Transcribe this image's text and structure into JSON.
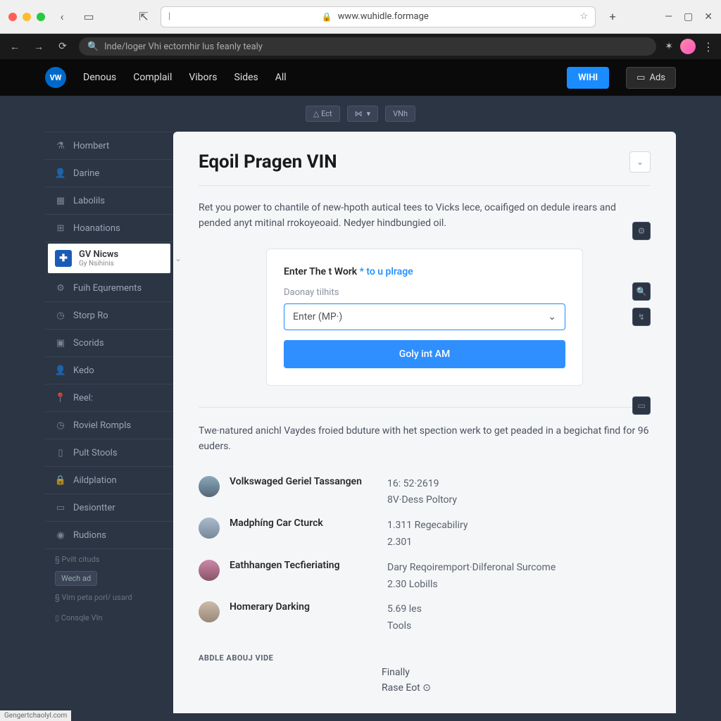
{
  "chrome": {
    "url": "www.wuhidle.formage",
    "inner_search": "lnde/loger Vhi ectornhir lus feanly tealy"
  },
  "nav": {
    "items": [
      "Denous",
      "Complail",
      "Vibors",
      "Sides",
      "All"
    ],
    "cta": "WIHI",
    "ads": "Ads"
  },
  "pills": [
    "△ Ect",
    "⋈",
    "VNh"
  ],
  "sidebar": {
    "items": [
      {
        "icon": "⚗",
        "label": "Hombert"
      },
      {
        "icon": "👤",
        "label": "Darine"
      },
      {
        "icon": "▦",
        "label": "Labolils"
      },
      {
        "icon": "⊞",
        "label": "Hoanations"
      },
      {
        "icon": "✚",
        "label": "GV Nicws",
        "sub": "Gy Nsihinis",
        "active": true
      },
      {
        "icon": "⚙",
        "label": "Fuih Equrements"
      },
      {
        "icon": "◷",
        "label": "Storp Ro"
      },
      {
        "icon": "▣",
        "label": "Scorids"
      },
      {
        "icon": "👤",
        "label": "Kedo"
      },
      {
        "icon": "📍",
        "label": "Reel:"
      },
      {
        "icon": "◷",
        "label": "Roviel Rompls"
      },
      {
        "icon": "▯",
        "label": "Pult Stools"
      },
      {
        "icon": "🔒",
        "label": "Aildplation"
      },
      {
        "icon": "▭",
        "label": "Desiontter"
      },
      {
        "icon": "◉",
        "label": "Rudions"
      }
    ],
    "notes": [
      "§ Pvilt cituds",
      "Wech ad",
      "§ Vim peta porl/ usard",
      "▯ Consqle VIn"
    ]
  },
  "content": {
    "title": "Eqoil Pragen VIN",
    "intro": "Ret you power to chantile of new-hpoth autical tees to Vicks lece, ocaifiged on dedule irears and pended anyt mitinal rrokoyeoaid. Nedyer hindbungied oil.",
    "form": {
      "heading": "Enter The t Work",
      "heading_hint": "* to u plrage",
      "field_label": "Daonay tilhits",
      "select_placeholder": "Enter (MP·)",
      "submit": "Goly int AM"
    },
    "lower": "Twe·natured anichl Vaydes froied bduture with het spection werk to get peaded in a begichat find for 96 euders.",
    "results": [
      {
        "name": "Volkswaged Geriel Tassangen",
        "meta1": "16: 52·2619",
        "meta2": "8V·Dess Poltory"
      },
      {
        "name": "Madphíng Car Cturck",
        "meta1": "1.311 Regecabiliry",
        "meta2": "2.301"
      },
      {
        "name": "Eathhangen Tecfieriating",
        "meta1": "Dary Reqoiremport·Dilferonal Surcome",
        "meta2": "2.30 Lobills"
      },
      {
        "name": "Homerary Darking",
        "meta1": "5.69 les",
        "meta2": "Tools"
      }
    ],
    "section_label": "ABDLE ABOUJ VIDE",
    "finally": "Finally",
    "rase": "Rase Eot ⊙"
  },
  "footer": "Gengertchaolyl.com"
}
